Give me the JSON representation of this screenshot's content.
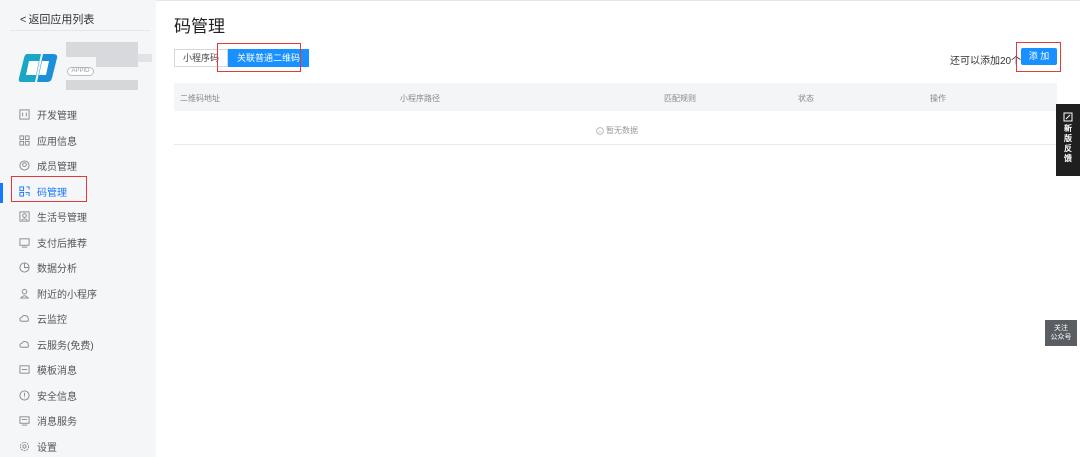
{
  "sidebar": {
    "back_label": "返回应用列表",
    "app_badge": "APPID",
    "items": [
      {
        "label": "开发管理",
        "icon": "code-box-icon"
      },
      {
        "label": "应用信息",
        "icon": "grid-icon"
      },
      {
        "label": "成员管理",
        "icon": "member-icon"
      },
      {
        "label": "码管理",
        "icon": "qrcode-icon",
        "active": true
      },
      {
        "label": "生活号管理",
        "icon": "life-account-icon"
      },
      {
        "label": "支付后推荐",
        "icon": "monitor-icon"
      },
      {
        "label": "数据分析",
        "icon": "pie-icon"
      },
      {
        "label": "附近的小程序",
        "icon": "location-person-icon"
      },
      {
        "label": "云监控",
        "icon": "cloud-icon"
      },
      {
        "label": "云服务(免费)",
        "icon": "cloud-service-icon"
      },
      {
        "label": "模板消息",
        "icon": "message-template-icon"
      },
      {
        "label": "安全信息",
        "icon": "shield-icon"
      },
      {
        "label": "消息服务",
        "icon": "message-service-icon"
      },
      {
        "label": "设置",
        "icon": "gear-icon"
      }
    ]
  },
  "main": {
    "title": "码管理",
    "tabs": [
      {
        "label": "小程序码",
        "active": false
      },
      {
        "label": "关联普通二维码",
        "active": true
      }
    ],
    "remaining_text": "还可以添加20个",
    "add_button": "添 加",
    "table": {
      "columns": [
        "二维码地址",
        "小程序路径",
        "匹配规则",
        "状态",
        "操作"
      ],
      "empty_text": "暂无数据"
    }
  },
  "floating": {
    "feedback_label": [
      "新",
      "版",
      "反",
      "馈"
    ],
    "follow_label_line1": "关注",
    "follow_label_line2": "公众号"
  },
  "colors": {
    "accent": "#1890ff",
    "highlight_box": "#e23a3a",
    "sidebar_bg": "#f5f6f8"
  }
}
